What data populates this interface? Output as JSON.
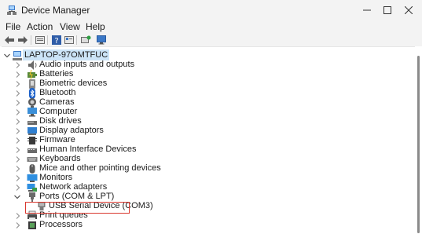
{
  "window": {
    "title": "Device Manager",
    "controls": {
      "minimize": "minimize-icon",
      "maximize": "maximize-icon",
      "close": "close-icon"
    }
  },
  "menu": [
    "File",
    "Action",
    "View",
    "Help"
  ],
  "toolbar": [
    "back-arrow-icon",
    "forward-arrow-icon",
    "properties-icon",
    "help-icon",
    "view-icon",
    "scan-hardware-icon",
    "monitor-icon"
  ],
  "tree": {
    "root": {
      "label": "LAPTOP-97OMTFUC",
      "icon": "computer-icon",
      "expanded": true
    },
    "items": [
      {
        "label": "Audio inputs and outputs",
        "icon": "speaker-icon"
      },
      {
        "label": "Batteries",
        "icon": "battery-icon"
      },
      {
        "label": "Biometric devices",
        "icon": "biometric-icon"
      },
      {
        "label": "Bluetooth",
        "icon": "bluetooth-icon"
      },
      {
        "label": "Cameras",
        "icon": "camera-icon"
      },
      {
        "label": "Computer",
        "icon": "computer-icon"
      },
      {
        "label": "Disk drives",
        "icon": "disk-icon"
      },
      {
        "label": "Display adaptors",
        "icon": "display-icon"
      },
      {
        "label": "Firmware",
        "icon": "firmware-icon"
      },
      {
        "label": "Human Interface Devices",
        "icon": "hid-icon"
      },
      {
        "label": "Keyboards",
        "icon": "keyboard-icon"
      },
      {
        "label": "Mice and other pointing devices",
        "icon": "mouse-icon"
      },
      {
        "label": "Monitors",
        "icon": "monitor-icon"
      },
      {
        "label": "Network adapters",
        "icon": "network-icon"
      },
      {
        "label": "Ports (COM & LPT)",
        "icon": "port-icon",
        "expanded": true
      },
      {
        "label": "USB Serial Device (COM3)",
        "icon": "usb-device-icon",
        "child": true,
        "highlighted": true
      },
      {
        "label": "Print queues",
        "icon": "printer-icon"
      },
      {
        "label": "Processors",
        "icon": "processor-icon"
      }
    ]
  },
  "colors": {
    "selection": "#cce4f7",
    "highlight_border": "#d9382f",
    "chrome": "#f3f3f3"
  }
}
